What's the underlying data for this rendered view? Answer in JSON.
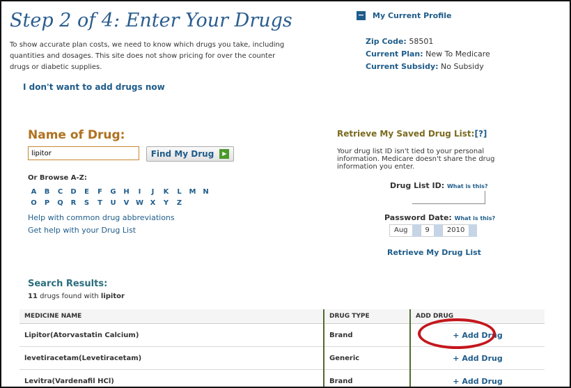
{
  "header": {
    "title": "Step 2 of 4: Enter Your Drugs",
    "intro": "To show accurate plan costs, we need to know which drugs you take, including quantities and dosages. This site does not show pricing for over the counter drugs or diabetic supplies.",
    "no_drugs_link": "I don't want to add drugs now"
  },
  "profile": {
    "heading": "My Current Profile",
    "zip_label": "Zip Code:",
    "zip_value": "58501",
    "plan_label": "Current Plan:",
    "plan_value": "New To Medicare",
    "subsidy_label": "Current Subsidy:",
    "subsidy_value": "No Subsidy"
  },
  "search": {
    "heading": "Name of Drug:",
    "input_value": "lipitor",
    "find_label": "Find My Drug",
    "browse_heading": "Or Browse A-Z:",
    "alpha_row1": [
      "A",
      "B",
      "C",
      "D",
      "E",
      "F",
      "G",
      "H",
      "I",
      "J",
      "K",
      "L",
      "M",
      "N"
    ],
    "alpha_row2": [
      "O",
      "P",
      "Q",
      "R",
      "S",
      "T",
      "U",
      "V",
      "W",
      "X",
      "Y",
      "Z"
    ],
    "help_abbrev": "Help with common drug abbreviations",
    "help_list": "Get help with your Drug List"
  },
  "retrieve": {
    "heading": "Retrieve My Saved Drug List:",
    "help_marker": "[?]",
    "text": "Your drug list ID isn't tied to your personal information. Medicare doesn't share the drug information you enter.",
    "id_label": "Drug List ID:",
    "what_is_this": "What is this?",
    "pw_label": "Password Date:",
    "pw_what": "What is this?",
    "month": "Aug",
    "day": "9",
    "year": "2010",
    "button_label": "Retrieve My Drug List"
  },
  "results": {
    "heading": "Search Results:",
    "count": "11",
    "found_text": "drugs found with",
    "query": "lipitor",
    "columns": [
      "MEDICINE NAME",
      "DRUG TYPE",
      "ADD DRUG"
    ],
    "rows": [
      {
        "name": "Lipitor(Atorvastatin Calcium)",
        "type": "Brand",
        "action": "+ Add Drug"
      },
      {
        "name": "levetiracetam(Levetiracetam)",
        "type": "Generic",
        "action": "+ Add Drug"
      },
      {
        "name": "Levitra(Vardenafil HCl)",
        "type": "Brand",
        "action": "+ Add Drug"
      }
    ]
  }
}
